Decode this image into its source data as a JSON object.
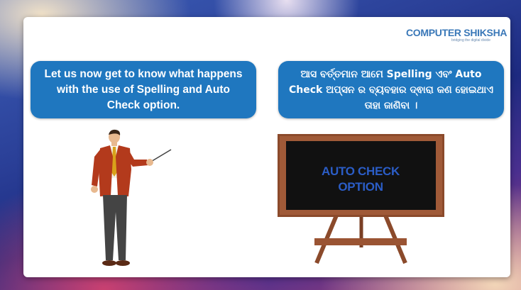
{
  "logo": {
    "name": "COMPUTER SHIKSHA",
    "tagline": "bridging the digital divide"
  },
  "bubble_english": {
    "text": "Let us now get to know what happens with the use of Spelling and Auto Check option."
  },
  "bubble_odia": {
    "text": "ଆସ ବର୍ତ୍ତମାନ ଆମେ Spelling ଏବଂ Auto Check ଅପ୍ସନ ର ବ୍ୟବହାର ଦ୍ଵାରା କଣ ହୋଇଥାଏ ତାହା ଜାଣିବା ।"
  },
  "blackboard": {
    "line1": "AUTO CHECK",
    "line2": "OPTION"
  },
  "colors": {
    "bubble": "#1f77bf",
    "board_frame": "#8b4a2b",
    "board_surface": "#111111",
    "board_text": "#2b5dc7"
  }
}
